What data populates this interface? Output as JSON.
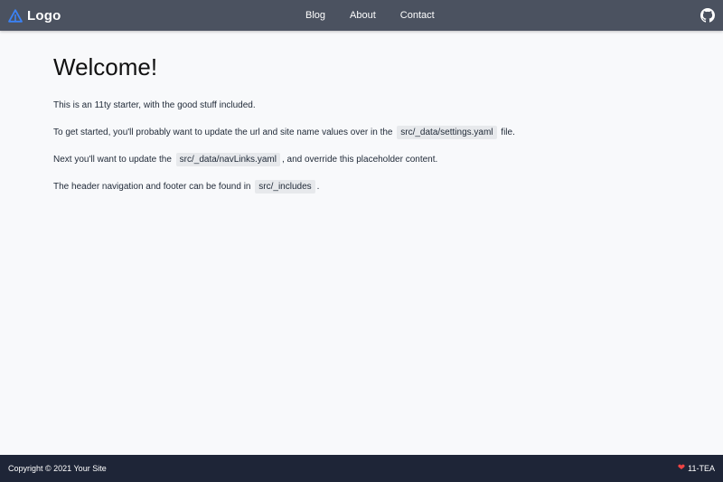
{
  "header": {
    "logo_text": "Logo",
    "nav": [
      {
        "label": "Blog"
      },
      {
        "label": "About"
      },
      {
        "label": "Contact"
      }
    ],
    "github_icon": "github-icon"
  },
  "main": {
    "title": "Welcome!",
    "p1": "This is an 11ty starter, with the good stuff included.",
    "p2_before": "To get started, you'll probably want to update the url and site name values over in the",
    "p2_code": "src/_data/settings.yaml",
    "p2_after": "file.",
    "p3_before": "Next you'll want to update the",
    "p3_code": "src/_data/navLinks.yaml",
    "p3_after": ", and override this placeholder content.",
    "p4_before": "The header navigation and footer can be found in",
    "p4_code": "src/_includes",
    "p4_after": "."
  },
  "footer": {
    "copyright": "Copyright © 2021 Your Site",
    "credit_icon": "heart-icon",
    "credit": "11-TEA"
  },
  "colors": {
    "header_bg": "#4b5260",
    "footer_bg": "#1e2537",
    "page_bg": "#f8f9fb",
    "logo_accent": "#3b82f6"
  }
}
